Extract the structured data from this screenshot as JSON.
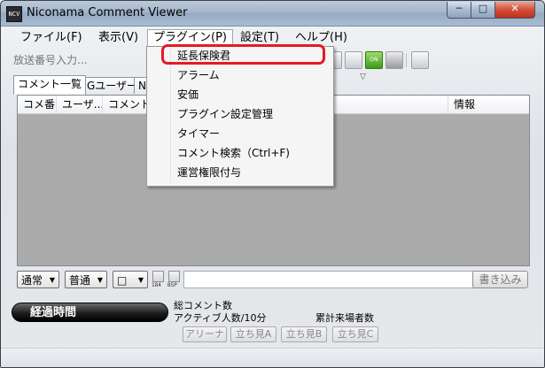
{
  "window": {
    "title": "Niconama Comment Viewer",
    "app_icon_text": "NCV",
    "controls": {
      "minimize": "─",
      "maximize": "□",
      "close": "✕"
    }
  },
  "menubar": {
    "items": [
      {
        "label": "ファイル(F)"
      },
      {
        "label": "表示(V)"
      },
      {
        "label": "プラグイン(P)"
      },
      {
        "label": "設定(T)"
      },
      {
        "label": "ヘルプ(H)"
      }
    ]
  },
  "toolbar": {
    "broadcast_placeholder": "放送番号入力...",
    "on_icon_text": "ON",
    "dropdown_arrow": "▽"
  },
  "tabs": [
    {
      "label": "コメント一覧"
    },
    {
      "label": "NGユーザー"
    },
    {
      "label": "N"
    }
  ],
  "list": {
    "columns": [
      {
        "label": "コメ番"
      },
      {
        "label": "ユーザ..."
      },
      {
        "label": "コメント"
      },
      {
        "label": "情報"
      }
    ]
  },
  "input_bar": {
    "mode_combo": "通常",
    "size_combo": "普通",
    "color_combo": "□",
    "chk_184": "184",
    "chk_bsp": "BSP",
    "post_button": "書き込み",
    "combo_arrow": "▼"
  },
  "status": {
    "timer_button": "経過時間",
    "total_comments": "総コメント数",
    "active_users": "アクティブ人数/10分",
    "total_visitors": "累計来場者数",
    "buttons": [
      {
        "label": "アリーナ"
      },
      {
        "label": "立ち見A"
      },
      {
        "label": "立ち見B"
      },
      {
        "label": "立ち見C"
      }
    ]
  },
  "plugin_menu": {
    "items": [
      {
        "label": "延長保険君"
      },
      {
        "label": "アラーム"
      },
      {
        "label": "安価"
      },
      {
        "label": "プラグイン設定管理"
      },
      {
        "label": "タイマー"
      },
      {
        "label": "コメント検索（Ctrl+F)"
      },
      {
        "label": "運営権限付与"
      }
    ],
    "highlight_color": "#e41b23"
  }
}
